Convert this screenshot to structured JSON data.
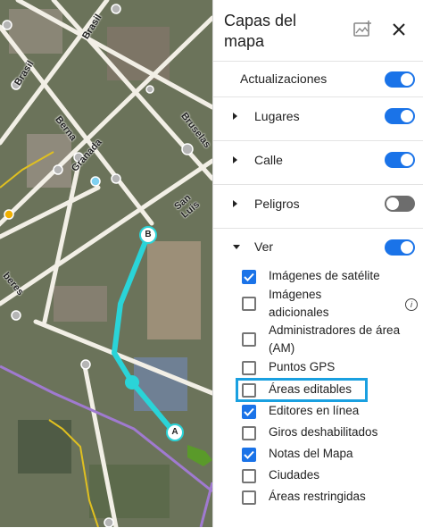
{
  "panel": {
    "title": "Capas del mapa",
    "title_line1": "Capas del",
    "title_line2": "mapa",
    "icons": [
      "map-photo-icon",
      "close-icon"
    ]
  },
  "layers": [
    {
      "label": "Actualizaciones",
      "expandable": false,
      "enabled": true
    },
    {
      "label": "Lugares",
      "expandable": true,
      "expanded": false,
      "enabled": true
    },
    {
      "label": "Calle",
      "expandable": true,
      "expanded": false,
      "enabled": true
    },
    {
      "label": "Peligros",
      "expandable": true,
      "expanded": false,
      "enabled": false
    },
    {
      "label": "Ver",
      "expandable": true,
      "expanded": true,
      "enabled": true
    }
  ],
  "ver_items": [
    {
      "label": "Imágenes de satélite",
      "checked": true
    },
    {
      "label": "Imágenes adicionales",
      "label_line1": "Imágenes",
      "label_line2": "adicionales",
      "checked": false,
      "info_icon": "info-icon"
    },
    {
      "label": "Administradores de área (AM)",
      "label_line1": "Administradores de área",
      "label_line2": "(AM)",
      "checked": false
    },
    {
      "label": "Puntos GPS",
      "checked": false
    },
    {
      "label": "Áreas editables",
      "checked": false,
      "highlighted": true
    },
    {
      "label": "Editores en línea",
      "checked": true
    },
    {
      "label": "Giros deshabilitados",
      "checked": false
    },
    {
      "label": "Notas del Mapa",
      "checked": true
    },
    {
      "label": "Ciudades",
      "checked": false
    },
    {
      "label": "Áreas restringidas",
      "checked": false
    }
  ],
  "map": {
    "street_labels": [
      "Brasil",
      "Brasil",
      "Berna",
      "Granada",
      "Bruselas",
      "San Luis",
      "beres"
    ],
    "node_labels": [
      "B",
      "A"
    ]
  },
  "colors": {
    "accent": "#1a73e8",
    "toggle_off": "#6d6d6d",
    "highlight": "#1aa0e0",
    "segment": "#2ad4d8",
    "arrow": "#5a9a2a"
  }
}
